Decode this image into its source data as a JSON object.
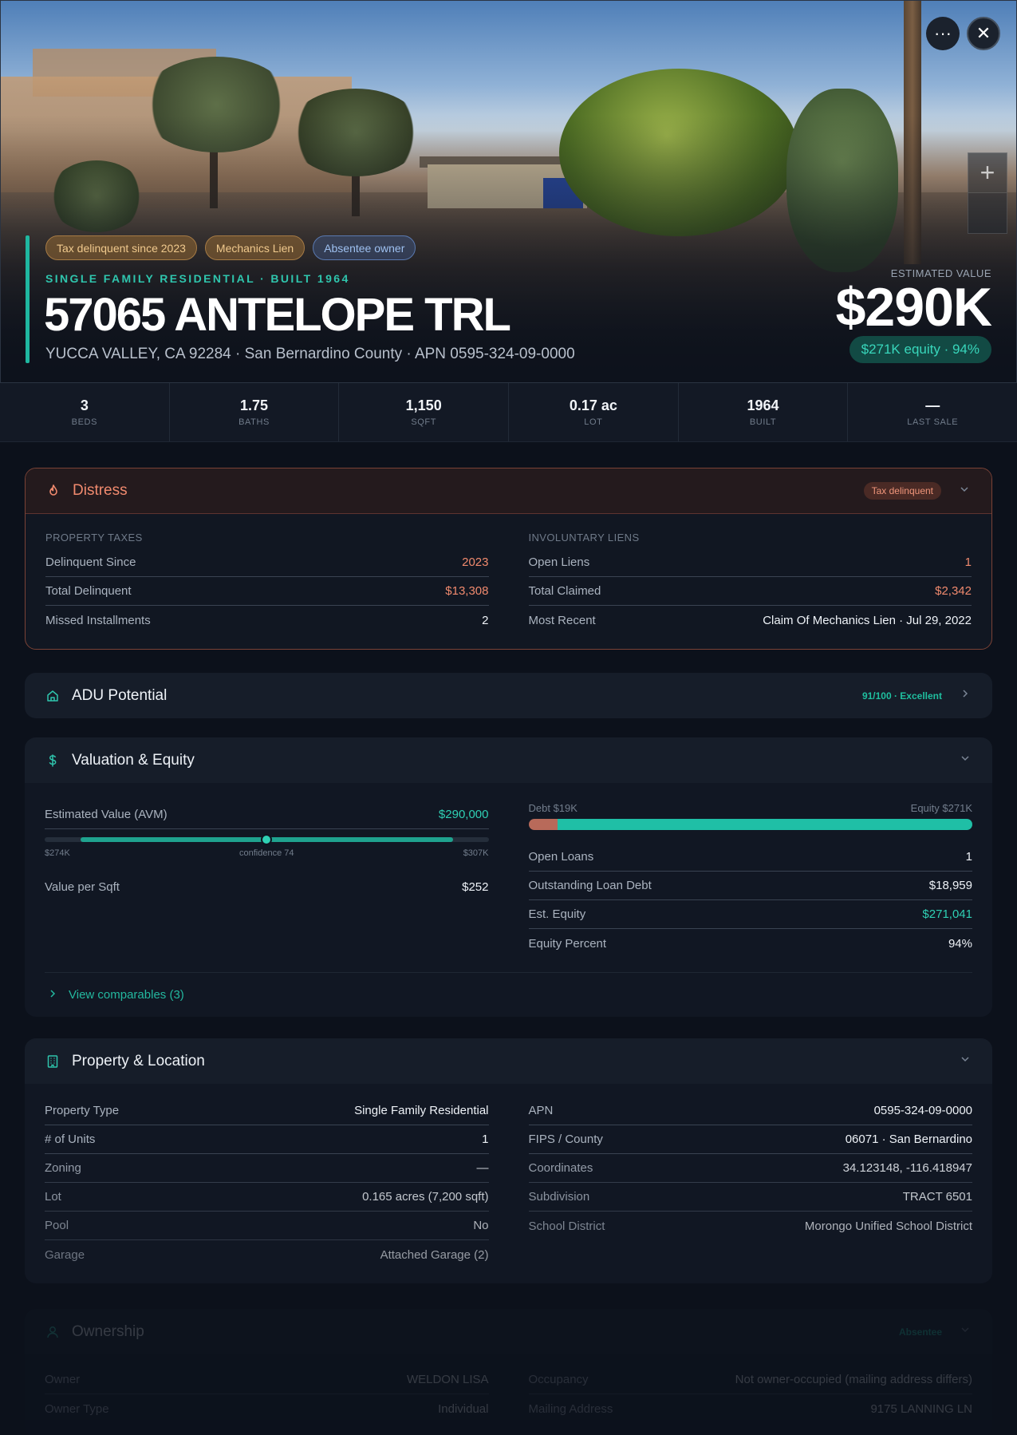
{
  "hero": {
    "tags": [
      {
        "label": "Tax delinquent since 2023",
        "kind": "warn"
      },
      {
        "label": "Mechanics Lien",
        "kind": "warn"
      },
      {
        "label": "Absentee owner",
        "kind": "info"
      }
    ],
    "subtitle": "SINGLE FAMILY RESIDENTIAL · BUILT 1964",
    "title": "57065 ANTELOPE TRL",
    "address": "YUCCA VALLEY, CA 92284 · San Bernardino County · APN 0595-324-09-0000",
    "estimated_label": "ESTIMATED VALUE",
    "estimated_value": "$290K",
    "equity_pill": "$271K equity · 94%",
    "more_icon": "···",
    "close_icon": "✕",
    "zoom_in_icon": "+"
  },
  "stats": [
    {
      "value": "3",
      "label": "BEDS"
    },
    {
      "value": "1.75",
      "label": "BATHS"
    },
    {
      "value": "1,150",
      "label": "SQFT"
    },
    {
      "value": "0.17 ac",
      "label": "LOT"
    },
    {
      "value": "1964",
      "label": "BUILT"
    },
    {
      "value": "—",
      "label": "LAST SALE"
    }
  ],
  "distress": {
    "title": "Distress",
    "badge": "Tax delinquent",
    "left": {
      "section": "PROPERTY TAXES",
      "rows": [
        {
          "k": "Delinquent Since",
          "v": "2023"
        },
        {
          "k": "Total Delinquent",
          "v": "$13,308"
        },
        {
          "k": "Missed Installments",
          "v": "2"
        }
      ]
    },
    "right": {
      "section": "INVOLUNTARY LIENS",
      "rows": [
        {
          "k": "Open Liens",
          "v": "1"
        },
        {
          "k": "Total Claimed",
          "v": "$2,342"
        },
        {
          "k": "Most Recent",
          "v": "Claim Of Mechanics Lien · Jul 29, 2022"
        }
      ]
    }
  },
  "adu": {
    "title": "ADU Potential",
    "score": "91/100 · Excellent"
  },
  "valuation": {
    "title": "Valuation & Equity",
    "avm_label": "Estimated Value (AVM)",
    "avm_value": "$290,000",
    "avm_low": "$274K",
    "avm_confidence": "confidence 74",
    "avm_high": "$307K",
    "avm_position": 0.5,
    "avm_range_start": 0.08,
    "avm_range_end": 0.92,
    "value_per_sqft_label": "Value per Sqft",
    "value_per_sqft": "$252",
    "debt_label": "Debt $19K",
    "equity_label": "Equity $271K",
    "debt_fraction": 0.065,
    "rows": [
      {
        "k": "Open Loans",
        "v": "1"
      },
      {
        "k": "Outstanding Loan Debt",
        "v": "$18,959"
      },
      {
        "k": "Est. Equity",
        "v": "$271,041"
      },
      {
        "k": "Equity Percent",
        "v": "94%"
      }
    ],
    "comps": "View comparables (3)"
  },
  "property": {
    "title": "Property & Location",
    "left": [
      {
        "k": "Property Type",
        "v": "Single Family Residential"
      },
      {
        "k": "# of Units",
        "v": "1"
      },
      {
        "k": "Zoning",
        "v": "—"
      },
      {
        "k": "Lot",
        "v": "0.165 acres (7,200 sqft)"
      },
      {
        "k": "Pool",
        "v": "No"
      },
      {
        "k": "Garage",
        "v": "Attached Garage (2)"
      }
    ],
    "right": [
      {
        "k": "APN",
        "v": "0595-324-09-0000"
      },
      {
        "k": "FIPS / County",
        "v": "06071 · San Bernardino"
      },
      {
        "k": "Coordinates",
        "v": "34.123148, -116.418947"
      },
      {
        "k": "Subdivision",
        "v": "TRACT 6501"
      },
      {
        "k": "School District",
        "v": "Morongo Unified School District"
      }
    ]
  },
  "ownership": {
    "title": "Ownership",
    "badge": "Absentee",
    "left": [
      {
        "k": "Owner",
        "v": "WELDON LISA"
      },
      {
        "k": "Owner Type",
        "v": "Individual"
      }
    ],
    "right": [
      {
        "k": "Occupancy",
        "v": "Not owner-occupied (mailing address differs)"
      },
      {
        "k": "Mailing Address",
        "v": "9175 LANNING LN"
      }
    ]
  },
  "colors": {
    "accent": "#1fb7a0",
    "danger": "#f08a6e",
    "background": "#0c111b"
  },
  "icons": {
    "distress": "flame-icon",
    "adu": "home-icon",
    "valuation": "dollar-icon",
    "property": "building-icon",
    "ownership": "user-icon"
  }
}
